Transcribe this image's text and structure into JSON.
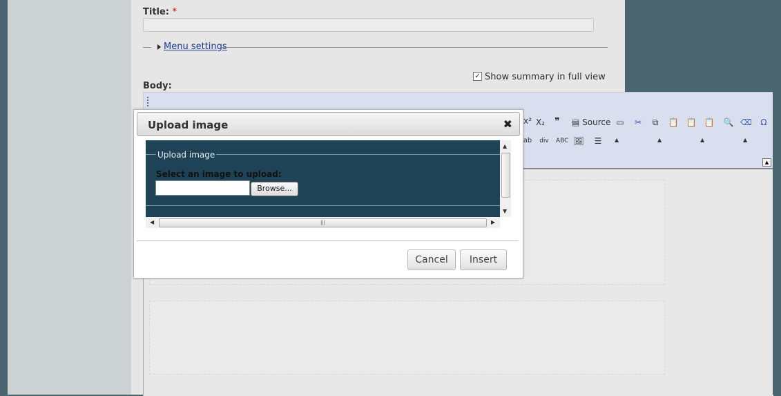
{
  "form": {
    "title_label": "Title:",
    "required_marker": "*",
    "title_value": "",
    "menu_settings_label": "Menu settings",
    "show_summary_label": "Show summary in full view",
    "show_summary_checked": true,
    "body_label": "Body:"
  },
  "toolbar": {
    "superscript": "x²",
    "subscript": "X₂",
    "blockquote": "❞",
    "source_label": "Source"
  },
  "dialog": {
    "title": "Upload image",
    "close_glyph": "✖",
    "fieldset_legend": "Upload image",
    "select_label": "Select an image to upload:",
    "file_value": "",
    "browse_label": "Browse...",
    "scroll_thumb_grip": "|||",
    "cancel_label": "Cancel",
    "insert_label": "Insert"
  },
  "colors": {
    "frame_bg": "#1e4256",
    "page_bg": "#e6e6e6",
    "outer_bg": "#4b6670",
    "toolbar_bg": "#d9dfee"
  }
}
